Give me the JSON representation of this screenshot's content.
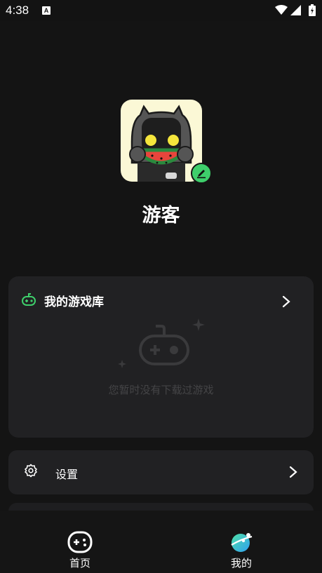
{
  "status_bar": {
    "time": "4:38",
    "notification_icon": "a-letter-icon",
    "wifi_icon": "wifi-icon",
    "signal_icon": "signal-icon",
    "battery_icon": "battery-charging-icon"
  },
  "profile": {
    "username": "游客",
    "avatar_icon": "watermelon-robot-avatar",
    "edit_icon": "pencil-icon"
  },
  "library": {
    "icon": "gamepad-icon",
    "title": "我的游戏库",
    "chevron": "chevron-right-icon",
    "empty_text": "您暂时没有下载过游戏"
  },
  "settings": {
    "icon": "gear-icon",
    "label": "设置",
    "chevron": "chevron-right-icon"
  },
  "bottom_nav": {
    "items": [
      {
        "label": "首页",
        "icon": "gamepad-home-icon",
        "active": false
      },
      {
        "label": "我的",
        "icon": "planet-profile-icon",
        "active": true
      }
    ]
  },
  "colors": {
    "background": "#141414",
    "card": "#212123",
    "accent_green": "#3ecf6b",
    "muted_text": "#444446"
  }
}
